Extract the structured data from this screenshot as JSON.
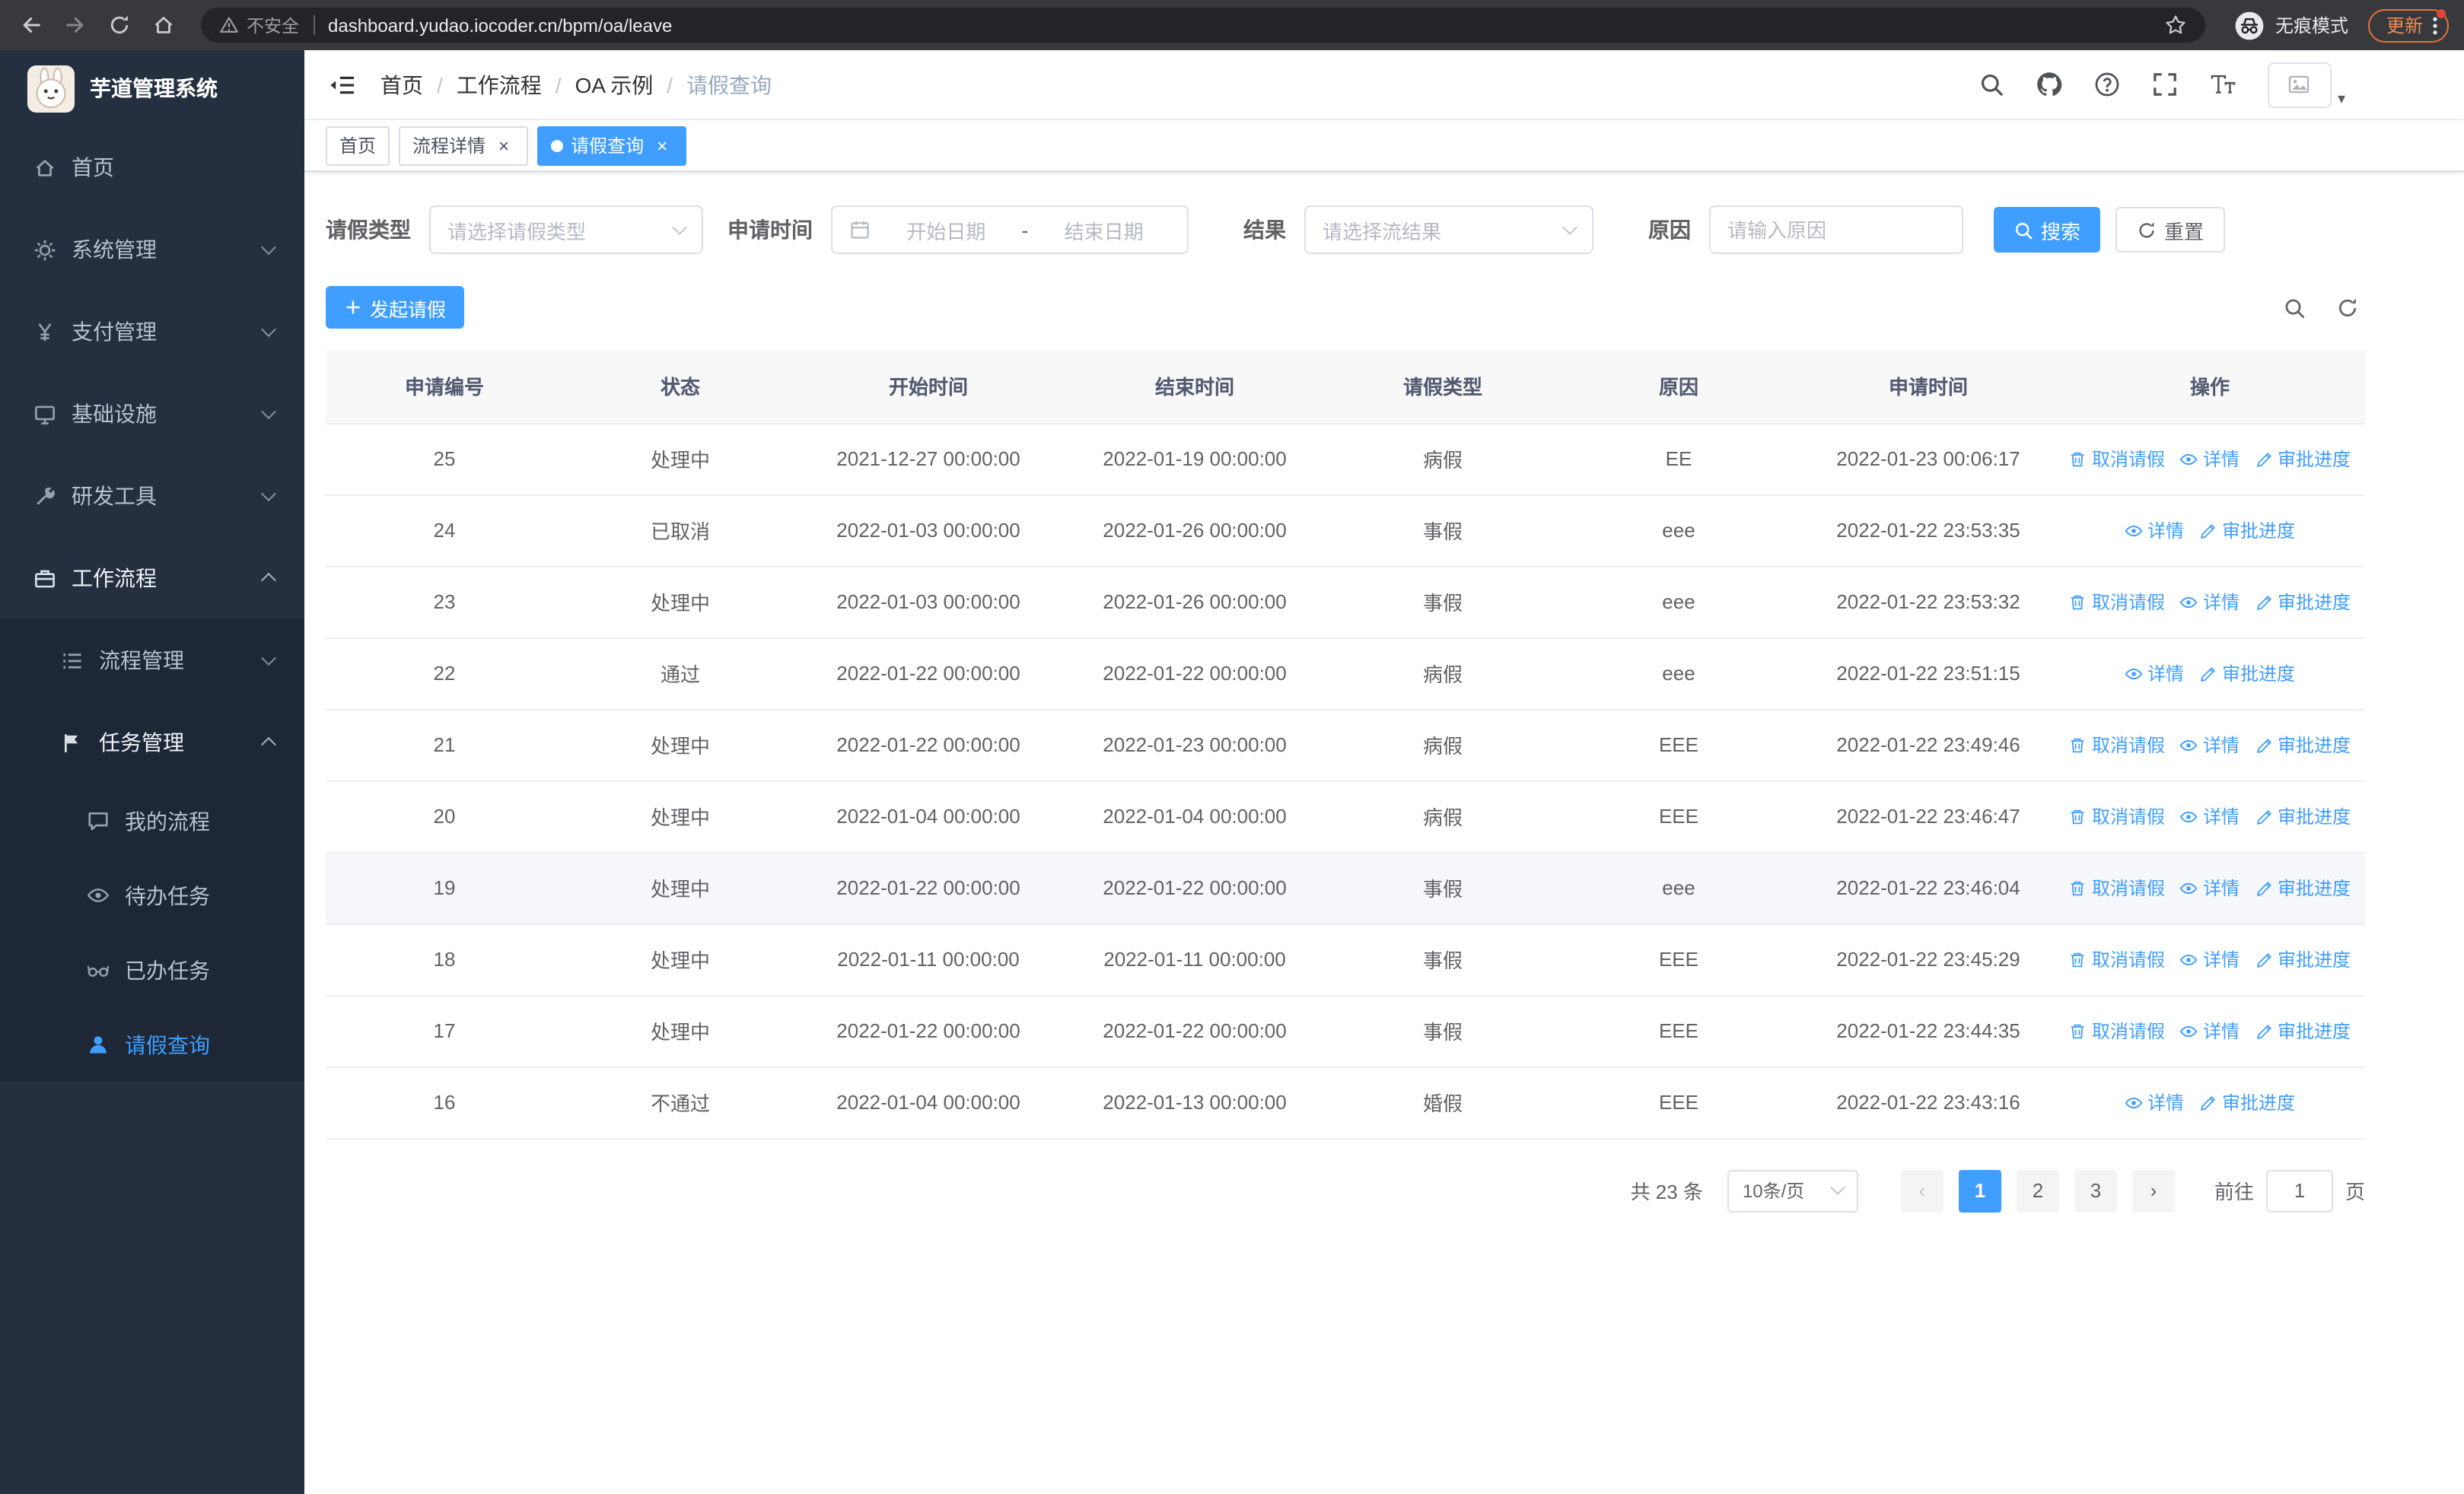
{
  "colors": {
    "accent": "#409eff",
    "sidebar_bg": "#24303f",
    "submenu_bg": "#1d2736",
    "table_header_bg": "#f8f8f9"
  },
  "browser": {
    "security_label": "不安全",
    "url": "dashboard.yudao.iocoder.cn/bpm/oa/leave",
    "incognito_label": "无痕模式",
    "update_label": "更新"
  },
  "sidebar": {
    "logo_title": "芋道管理系统",
    "items": [
      {
        "id": "home",
        "label": "首页",
        "icon": "home-icon",
        "level": 1
      },
      {
        "id": "system-mgmt",
        "label": "系统管理",
        "icon": "gear-icon",
        "level": 1,
        "chevron": "down"
      },
      {
        "id": "payment-mgmt",
        "label": "支付管理",
        "icon": "yen-icon",
        "level": 1,
        "chevron": "down"
      },
      {
        "id": "infrastructure",
        "label": "基础设施",
        "icon": "infra-icon",
        "level": 1,
        "chevron": "down"
      },
      {
        "id": "dev-tools",
        "label": "研发工具",
        "icon": "tools-icon",
        "level": 1,
        "chevron": "down"
      },
      {
        "id": "workflow",
        "label": "工作流程",
        "icon": "briefcase-icon",
        "level": 1,
        "chevron": "up",
        "parent_active": true
      },
      {
        "id": "process-mgmt",
        "label": "流程管理",
        "icon": "list-icon",
        "level": 2,
        "chevron": "down",
        "in_submenu": true
      },
      {
        "id": "task-mgmt",
        "label": "任务管理",
        "icon": "flag-icon",
        "level": 2,
        "chevron": "up",
        "parent_active": true,
        "in_submenu": true
      },
      {
        "id": "my-process",
        "label": "我的流程",
        "icon": "chat-icon",
        "level": 3,
        "in_submenu": true
      },
      {
        "id": "todo-task",
        "label": "待办任务",
        "icon": "eye-icon",
        "level": 3,
        "in_submenu": true
      },
      {
        "id": "done-task",
        "label": "已办任务",
        "icon": "glasses-icon",
        "level": 3,
        "in_submenu": true
      },
      {
        "id": "leave-query",
        "label": "请假查询",
        "icon": "user-icon",
        "level": 3,
        "active": true,
        "in_submenu": true
      }
    ]
  },
  "header": {
    "breadcrumb": [
      "首页",
      "工作流程",
      "OA 示例",
      "请假查询"
    ],
    "action_icons": [
      "search-icon",
      "github-icon",
      "question-icon",
      "fullscreen-icon",
      "fontsize-icon"
    ]
  },
  "tabs": [
    {
      "id": "home",
      "label": "首页",
      "closable": false,
      "active": false
    },
    {
      "id": "process-detail",
      "label": "流程详情",
      "closable": true,
      "active": false
    },
    {
      "id": "leave-query",
      "label": "请假查询",
      "closable": true,
      "active": true
    }
  ],
  "filters": {
    "leave_type_label": "请假类型",
    "leave_type_placeholder": "请选择请假类型",
    "apply_time_label": "申请时间",
    "start_date_placeholder": "开始日期",
    "range_separator": "-",
    "end_date_placeholder": "结束日期",
    "result_label": "结果",
    "result_placeholder": "请选择流结果",
    "reason_label": "原因",
    "reason_placeholder": "请输入原因",
    "search_label": "搜索",
    "reset_label": "重置"
  },
  "toolbar": {
    "create_label": "发起请假"
  },
  "table": {
    "columns": [
      "申请编号",
      "状态",
      "开始时间",
      "结束时间",
      "请假类型",
      "原因",
      "申请时间",
      "操作"
    ],
    "hovered_row_id": "19",
    "rows": [
      {
        "id": "25",
        "status": "处理中",
        "start": "2021-12-27 00:00:00",
        "end": "2022-01-19 00:00:00",
        "type": "病假",
        "reason": "EE",
        "apply_time": "2022-01-23 00:06:17",
        "ops": [
          {
            "name": "cancel",
            "label": "取消请假",
            "icon": "trash-icon"
          },
          {
            "name": "detail",
            "label": "详情",
            "icon": "eye-icon"
          },
          {
            "name": "progress",
            "label": "审批进度",
            "icon": "edit-icon"
          }
        ]
      },
      {
        "id": "24",
        "status": "已取消",
        "start": "2022-01-03 00:00:00",
        "end": "2022-01-26 00:00:00",
        "type": "事假",
        "reason": "eee",
        "apply_time": "2022-01-22 23:53:35",
        "ops": [
          {
            "name": "detail",
            "label": "详情",
            "icon": "eye-icon"
          },
          {
            "name": "progress",
            "label": "审批进度",
            "icon": "edit-icon"
          }
        ]
      },
      {
        "id": "23",
        "status": "处理中",
        "start": "2022-01-03 00:00:00",
        "end": "2022-01-26 00:00:00",
        "type": "事假",
        "reason": "eee",
        "apply_time": "2022-01-22 23:53:32",
        "ops": [
          {
            "name": "cancel",
            "label": "取消请假",
            "icon": "trash-icon"
          },
          {
            "name": "detail",
            "label": "详情",
            "icon": "eye-icon"
          },
          {
            "name": "progress",
            "label": "审批进度",
            "icon": "edit-icon"
          }
        ]
      },
      {
        "id": "22",
        "status": "通过",
        "start": "2022-01-22 00:00:00",
        "end": "2022-01-22 00:00:00",
        "type": "病假",
        "reason": "eee",
        "apply_time": "2022-01-22 23:51:15",
        "ops": [
          {
            "name": "detail",
            "label": "详情",
            "icon": "eye-icon"
          },
          {
            "name": "progress",
            "label": "审批进度",
            "icon": "edit-icon"
          }
        ]
      },
      {
        "id": "21",
        "status": "处理中",
        "start": "2022-01-22 00:00:00",
        "end": "2022-01-23 00:00:00",
        "type": "病假",
        "reason": "EEE",
        "apply_time": "2022-01-22 23:49:46",
        "ops": [
          {
            "name": "cancel",
            "label": "取消请假",
            "icon": "trash-icon"
          },
          {
            "name": "detail",
            "label": "详情",
            "icon": "eye-icon"
          },
          {
            "name": "progress",
            "label": "审批进度",
            "icon": "edit-icon"
          }
        ]
      },
      {
        "id": "20",
        "status": "处理中",
        "start": "2022-01-04 00:00:00",
        "end": "2022-01-04 00:00:00",
        "type": "病假",
        "reason": "EEE",
        "apply_time": "2022-01-22 23:46:47",
        "ops": [
          {
            "name": "cancel",
            "label": "取消请假",
            "icon": "trash-icon"
          },
          {
            "name": "detail",
            "label": "详情",
            "icon": "eye-icon"
          },
          {
            "name": "progress",
            "label": "审批进度",
            "icon": "edit-icon"
          }
        ]
      },
      {
        "id": "19",
        "status": "处理中",
        "start": "2022-01-22 00:00:00",
        "end": "2022-01-22 00:00:00",
        "type": "事假",
        "reason": "eee",
        "apply_time": "2022-01-22 23:46:04",
        "ops": [
          {
            "name": "cancel",
            "label": "取消请假",
            "icon": "trash-icon"
          },
          {
            "name": "detail",
            "label": "详情",
            "icon": "eye-icon"
          },
          {
            "name": "progress",
            "label": "审批进度",
            "icon": "edit-icon"
          }
        ]
      },
      {
        "id": "18",
        "status": "处理中",
        "start": "2022-01-11 00:00:00",
        "end": "2022-01-11 00:00:00",
        "type": "事假",
        "reason": "EEE",
        "apply_time": "2022-01-22 23:45:29",
        "ops": [
          {
            "name": "cancel",
            "label": "取消请假",
            "icon": "trash-icon"
          },
          {
            "name": "detail",
            "label": "详情",
            "icon": "eye-icon"
          },
          {
            "name": "progress",
            "label": "审批进度",
            "icon": "edit-icon"
          }
        ]
      },
      {
        "id": "17",
        "status": "处理中",
        "start": "2022-01-22 00:00:00",
        "end": "2022-01-22 00:00:00",
        "type": "事假",
        "reason": "EEE",
        "apply_time": "2022-01-22 23:44:35",
        "ops": [
          {
            "name": "cancel",
            "label": "取消请假",
            "icon": "trash-icon"
          },
          {
            "name": "detail",
            "label": "详情",
            "icon": "eye-icon"
          },
          {
            "name": "progress",
            "label": "审批进度",
            "icon": "edit-icon"
          }
        ]
      },
      {
        "id": "16",
        "status": "不通过",
        "start": "2022-01-04 00:00:00",
        "end": "2022-01-13 00:00:00",
        "type": "婚假",
        "reason": "EEE",
        "apply_time": "2022-01-22 23:43:16",
        "ops": [
          {
            "name": "detail",
            "label": "详情",
            "icon": "eye-icon"
          },
          {
            "name": "progress",
            "label": "审批进度",
            "icon": "edit-icon"
          }
        ]
      }
    ]
  },
  "pagination": {
    "total_label": "共 23 条",
    "page_size_label": "10条/页",
    "pages": [
      "1",
      "2",
      "3"
    ],
    "active_page": "1",
    "prev_symbol": "‹",
    "next_symbol": "›",
    "goto_label": "前往",
    "goto_value": "1",
    "page_unit_label": "页"
  }
}
